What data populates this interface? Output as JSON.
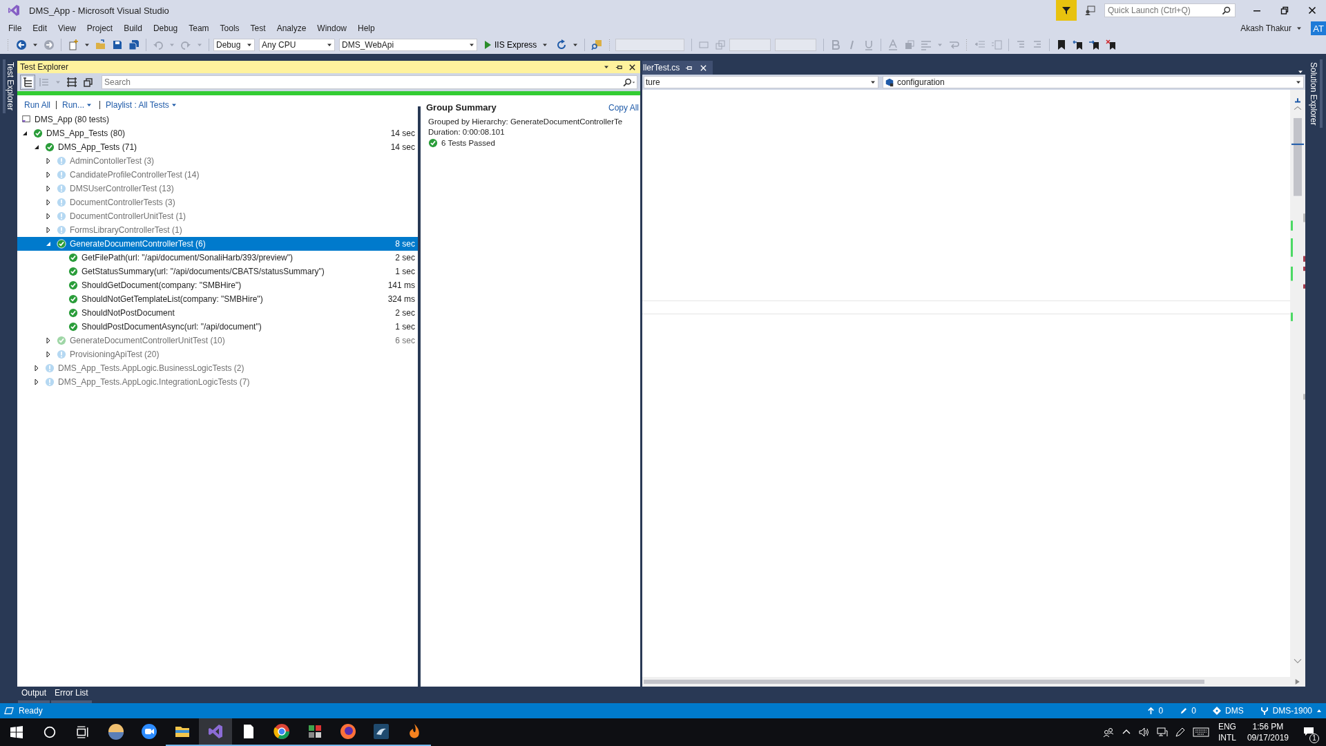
{
  "window": {
    "title": "DMS_App - Microsoft Visual Studio",
    "quick_launch_placeholder": "Quick Launch (Ctrl+Q)",
    "user": "Akash Thakur",
    "avatar": "AT"
  },
  "menu": [
    "File",
    "Edit",
    "View",
    "Project",
    "Build",
    "Debug",
    "Team",
    "Tools",
    "Test",
    "Analyze",
    "Window",
    "Help"
  ],
  "toolbar": {
    "configuration": "Debug",
    "platform": "Any CPU",
    "startup_project": "DMS_WebApi",
    "run_target": "IIS Express"
  },
  "side_tabs": {
    "left": "Test Explorer",
    "right": "Solution Explorer"
  },
  "test_explorer": {
    "title": "Test Explorer",
    "search_placeholder": "Search",
    "run_bar": {
      "level": 1
    },
    "actions": [
      {
        "label": "Run All",
        "kind": "link"
      },
      {
        "label": "Run...",
        "kind": "menu"
      },
      {
        "label": "Playlist : All Tests",
        "kind": "menu"
      }
    ],
    "solution": "DMS_App (80 tests)",
    "tree": [
      {
        "label": "DMS_App_Tests (80)",
        "kind": "passed",
        "time": "14 sec",
        "expanded": true,
        "selected": false,
        "children": [
          {
            "label": "DMS_App_Tests (71)",
            "kind": "passed",
            "time": "14 sec",
            "expanded": true,
            "selected": false,
            "children": [
              {
                "label": "AdminContollerTest (3)",
                "kind": "pending",
                "expanded": false,
                "selected": false
              },
              {
                "label": "CandidateProfileControllerTest (14)",
                "kind": "pending",
                "expanded": false,
                "selected": false
              },
              {
                "label": "DMSUserControllerTest (13)",
                "kind": "pending",
                "expanded": false,
                "selected": false
              },
              {
                "label": "DocumentControllerTests (3)",
                "kind": "pending",
                "expanded": false,
                "selected": false
              },
              {
                "label": "DocumentControllerUnitTest (1)",
                "kind": "pending",
                "expanded": false,
                "selected": false
              },
              {
                "label": "FormsLibraryControllerTest (1)",
                "kind": "pending",
                "expanded": false,
                "selected": false
              },
              {
                "label": "GenerateDocumentControllerTest (6)",
                "kind": "passed",
                "time": "8 sec",
                "expanded": true,
                "selected": true,
                "children": [
                  {
                    "label": "GetFilePath(url: \"/api/document/SonaliHarb/393/preview\")",
                    "kind": "passed",
                    "time": "2 sec",
                    "selected": false
                  },
                  {
                    "label": "GetStatusSummary(url: \"/api/documents/CBATS/statusSummary\")",
                    "kind": "passed",
                    "time": "1 sec",
                    "selected": false
                  },
                  {
                    "label": "ShouldGetDocument(company: \"SMBHire\")",
                    "kind": "passed",
                    "time": "141 ms",
                    "selected": false
                  },
                  {
                    "label": "ShouldNotGetTemplateList(company: \"SMBHire\")",
                    "kind": "passed",
                    "time": "324 ms",
                    "selected": false
                  },
                  {
                    "label": "ShouldNotPostDocument",
                    "kind": "passed",
                    "time": "2 sec",
                    "selected": false
                  },
                  {
                    "label": "ShouldPostDocumentAsync(url: \"/api/document\")",
                    "kind": "passed",
                    "time": "1 sec",
                    "selected": false
                  }
                ]
              },
              {
                "label": "GenerateDocumentControllerUnitTest (10)",
                "kind": "stale",
                "time": "6 sec",
                "expanded": false,
                "selected": false
              },
              {
                "label": "ProvisioningApiTest (20)",
                "kind": "pending",
                "expanded": false,
                "selected": false
              }
            ]
          },
          {
            "label": "DMS_App_Tests.AppLogic.BusinessLogicTests (2)",
            "kind": "pending",
            "expanded": false,
            "selected": false
          },
          {
            "label": "DMS_App_Tests.AppLogic.IntegrationLogicTests (7)",
            "kind": "pending",
            "expanded": false,
            "selected": false
          }
        ]
      }
    ]
  },
  "group_summary": {
    "title": "Group Summary",
    "copy": "Copy All",
    "grouped_by": "Grouped by Hierarchy: GenerateDocumentControllerTe",
    "duration": "Duration: 0:00:08.101",
    "result": "6 Tests Passed"
  },
  "editor": {
    "tab": "llerTest.cs",
    "nav_left": "ture",
    "nav_right": "configuration"
  },
  "bottom_tabs": [
    {
      "label": "Output",
      "selected": false
    },
    {
      "label": "Error List",
      "selected": false
    }
  ],
  "status_bar": {
    "text": "Ready",
    "pushes": "0",
    "changes": "0",
    "repo": "DMS",
    "branch": "DMS-1900"
  },
  "taskbar": {
    "apps": [
      {
        "selected": false,
        "running": false
      },
      {
        "selected": false,
        "running": false
      },
      {
        "selected": false,
        "running": true
      },
      {
        "selected": true,
        "running": true
      },
      {
        "selected": false,
        "running": true
      },
      {
        "selected": false,
        "running": true
      },
      {
        "selected": false,
        "running": true
      },
      {
        "selected": false,
        "running": true
      },
      {
        "selected": false,
        "running": true
      },
      {
        "selected": false,
        "running": true
      }
    ],
    "language": "ENG",
    "layout": "INTL",
    "time": "1:56 PM",
    "date": "09/17/2019",
    "notifications": "1"
  }
}
